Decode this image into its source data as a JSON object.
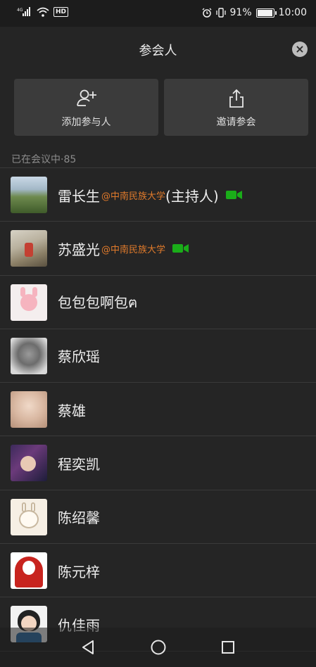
{
  "status": {
    "time": "10:00",
    "battery": "91%",
    "net": "HD",
    "signal": "4G"
  },
  "header": {
    "title": "参会人",
    "close": "×"
  },
  "actions": {
    "add_label": "添加参与人",
    "invite_label": "邀请参会"
  },
  "section": {
    "label": "已在会议中·85"
  },
  "participants": [
    {
      "name": "雷长生",
      "org": "@中南民族大学",
      "host": "(主持人)"
    },
    {
      "name": "苏盛光",
      "org": "@中南民族大学"
    },
    {
      "name": "包包包啊包ฅ"
    },
    {
      "name": "蔡欣瑶"
    },
    {
      "name": "蔡雄"
    },
    {
      "name": "程奕凯"
    },
    {
      "name": "陈绍馨"
    },
    {
      "name": "陈元梓"
    },
    {
      "name": "仇佳雨"
    }
  ],
  "colors": {
    "org": "#e07a2b",
    "camera": "#1aad19",
    "background": "#252525"
  },
  "icons": {
    "camera": "video-camera-icon",
    "back": "back-triangle-icon",
    "home": "home-circle-icon",
    "recents": "recents-square-icon"
  }
}
